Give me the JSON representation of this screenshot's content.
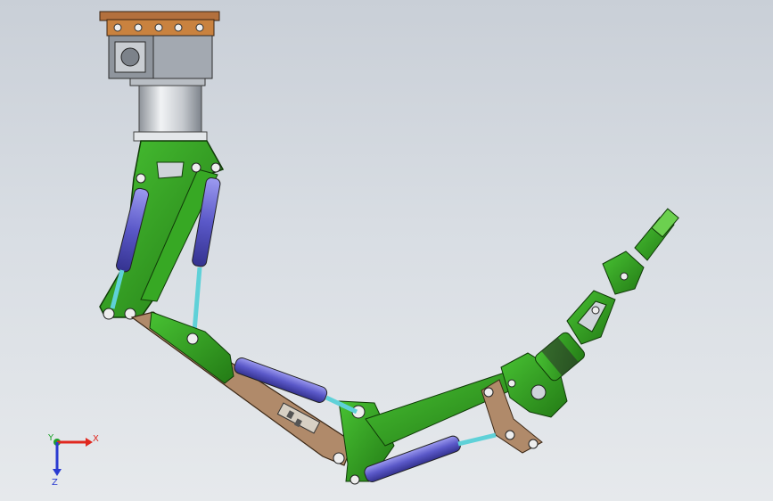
{
  "view": {
    "type": "3d-cad-viewport",
    "background_top": "#c9cfd7",
    "background_bottom": "#e6e9ec"
  },
  "colors": {
    "green": "#2e9b1e",
    "green_dark": "#1d5e12",
    "cylinder_blue": "#5a58c8",
    "cylinder_light": "#8b8ae6",
    "rod_cyan": "#5fd1d8",
    "plate_brown": "#b08a6a",
    "copper": "#b3703d",
    "gray_metal": "#9aa0a8",
    "silver": "#d6d9de"
  },
  "triad": {
    "x_label": "X",
    "y_label": "Y",
    "z_label": "Z",
    "x_color": "#e0281f",
    "y_color": "#1fa22b",
    "z_color": "#2a3bd1"
  }
}
